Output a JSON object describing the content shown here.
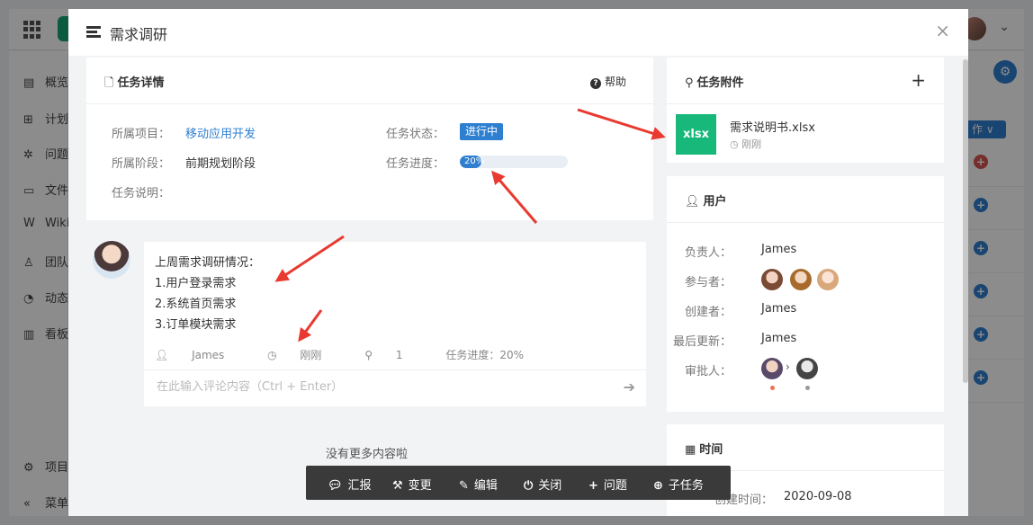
{
  "background": {
    "sidebar_items": [
      {
        "label": "概览",
        "icon": "list-icon"
      },
      {
        "label": "计划",
        "icon": "sitemap-icon"
      },
      {
        "label": "问题",
        "icon": "bug-icon"
      },
      {
        "label": "文件",
        "icon": "folder-icon"
      },
      {
        "label": "Wiki",
        "icon": "wiki-icon"
      },
      {
        "label": "团队",
        "icon": "team-icon"
      },
      {
        "label": "动态",
        "icon": "activity-icon"
      },
      {
        "label": "看板",
        "icon": "chart-icon"
      }
    ],
    "sidebar_bottom": [
      {
        "label": "项目",
        "icon": "gear-icon"
      },
      {
        "label": "菜单",
        "icon": "collapse-icon"
      }
    ],
    "action_button_label": "作 ∨"
  },
  "modal": {
    "title": "需求调研",
    "close_glyph": "×"
  },
  "detail": {
    "header_title": "任务详情",
    "help_label": "帮助",
    "project_label": "所属项目：",
    "project_value": "移动应用开发",
    "stage_label": "所属阶段：",
    "stage_value": "前期规划阶段",
    "desc_label": "任务说明：",
    "status_label": "任务状态：",
    "status_value": "进行中",
    "progress_label": "任务进度：",
    "progress_text": "20%",
    "progress_fraction": 0.2,
    "colors": {
      "accent": "#2e7fd0"
    }
  },
  "comment": {
    "lines": [
      "上周需求调研情况：",
      "1.用户登录需求",
      "2.系统首页需求",
      "3.订单模块需求"
    ],
    "author": "James",
    "time": "刚刚",
    "attachments": "1",
    "progress_meta": "任务进度：20%",
    "input_placeholder": "在此输入评论内容（Ctrl + Enter）"
  },
  "no_more_text": "没有更多内容啦",
  "toolbar": [
    {
      "label": "汇报",
      "icon": "comment-icon"
    },
    {
      "label": "变更",
      "icon": "gavel-icon"
    },
    {
      "label": "编辑",
      "icon": "edit-icon"
    },
    {
      "label": "关闭",
      "icon": "power-icon"
    },
    {
      "label": "问题",
      "icon": "plus-icon"
    },
    {
      "label": "子任务",
      "icon": "plus-circle-icon"
    }
  ],
  "attachments": {
    "header_title": "任务附件",
    "file_badge": "xlsx",
    "file_name": "需求说明书.xlsx",
    "file_time": "刚刚",
    "colors": {
      "file_badge": "#17b87a"
    }
  },
  "users": {
    "header_title": "用户",
    "owner_label": "负责人：",
    "owner_value": "James",
    "participants_label": "参与者：",
    "creator_label": "创建者：",
    "creator_value": "James",
    "updater_label": "最后更新：",
    "updater_value": "James",
    "approver_label": "审批人："
  },
  "time": {
    "header_title": "时间",
    "created_label": "创建时间：",
    "created_value": "2020-09-08"
  }
}
